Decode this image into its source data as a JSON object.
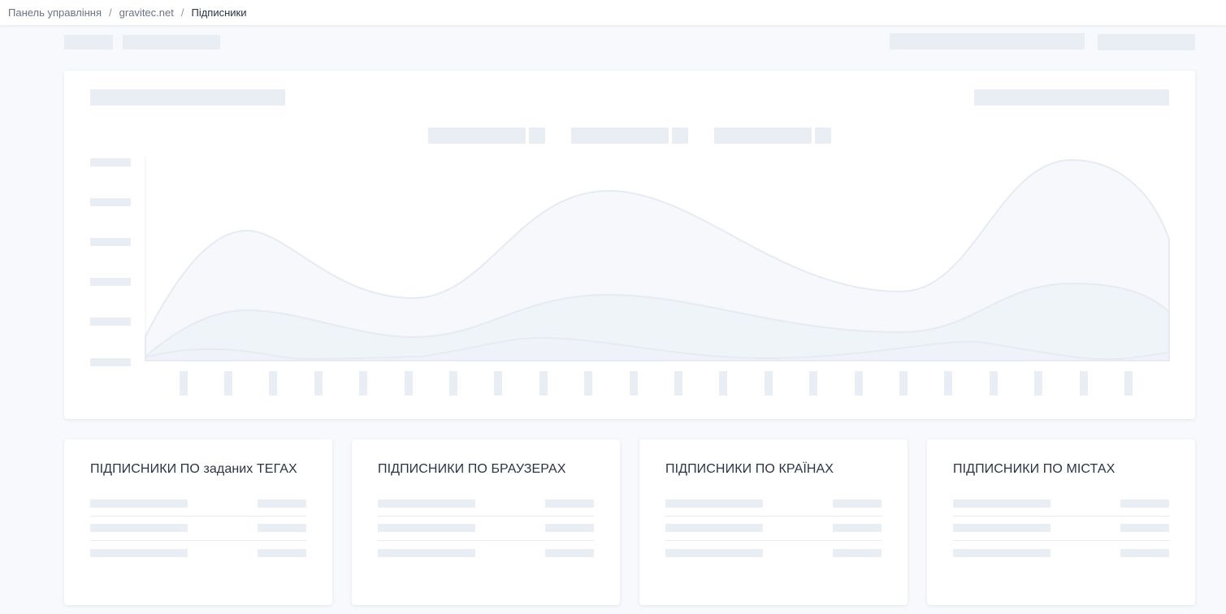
{
  "breadcrumb": {
    "items": [
      "Панель управління",
      "gravitec.net",
      "Підписники"
    ],
    "separator": "/"
  },
  "cards": {
    "tags_title": "ПІДПИСНИКИ ПО заданих ТЕГАХ",
    "browsers_title": "ПІДПИСНИКИ ПО БРАУЗЕРАХ",
    "countries_title": "ПІДПИСНИКИ ПО КРАЇНАХ",
    "cities_title": "ПІДПИСНИКИ ПО МІСТАХ"
  },
  "state": "loading-skeleton",
  "colors": {
    "background": "#f7f9fc",
    "card": "#ffffff",
    "skeleton": "#e9edf4",
    "chart_area": "#eef2f8"
  }
}
